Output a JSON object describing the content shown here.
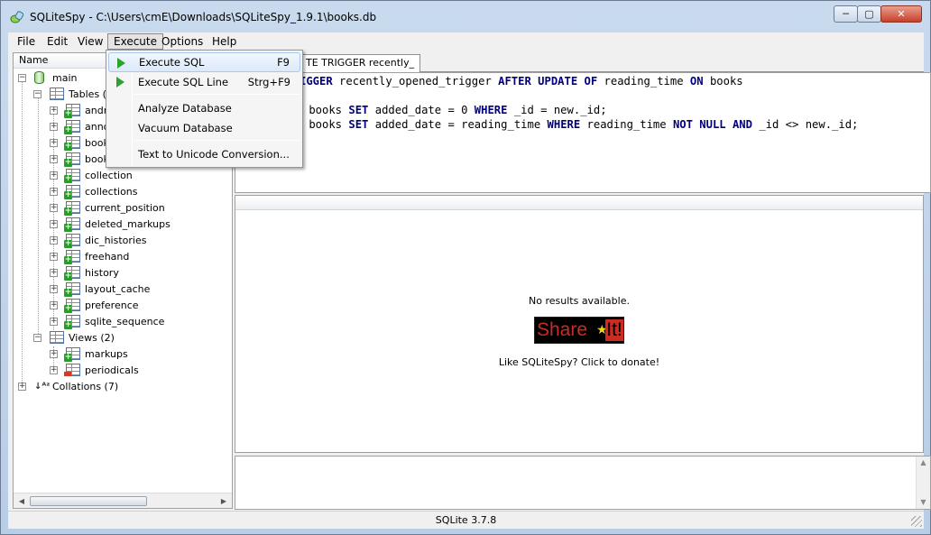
{
  "window": {
    "title": "SQLiteSpy - C:\\Users\\cmE\\Downloads\\SQLiteSpy_1.9.1\\books.db",
    "minimize": "─",
    "maximize": "▢",
    "close": "✕"
  },
  "menubar": [
    "File",
    "Edit",
    "View",
    "Execute",
    "Options",
    "Help"
  ],
  "execute_menu": {
    "items": [
      {
        "label": "Execute SQL",
        "shortcut": "F9",
        "icon": "play-icon"
      },
      {
        "label": "Execute SQL Line",
        "shortcut": "Strg+F9",
        "icon": "play-icon"
      },
      {
        "label": "Analyze Database"
      },
      {
        "label": "Vacuum Database"
      },
      {
        "label": "Text to Unicode Conversion..."
      }
    ]
  },
  "tree": {
    "header": "Name",
    "root": "main",
    "tables_label": "Tables (1",
    "tables": [
      "andro",
      "anno",
      "book",
      "book",
      "collection",
      "collections",
      "current_position",
      "deleted_markups",
      "dic_histories",
      "freehand",
      "history",
      "layout_cache",
      "preference",
      "sqlite_sequence"
    ],
    "views_label": "Views (2)",
    "views": [
      "markups",
      "periodicals"
    ],
    "collations_label": "Collations (7)"
  },
  "editor": {
    "tab_label": "TE TRIGGER recently_",
    "lines": [
      [
        {
          "t": "IGGER",
          "k": true
        },
        {
          "t": " recently_opened_trigger ",
          "k": false
        },
        {
          "t": "AFTER UPDATE OF",
          "k": true
        },
        {
          "t": " reading_time ",
          "k": false
        },
        {
          "t": "ON",
          "k": true
        },
        {
          "t": " books",
          "k": false
        }
      ],
      [],
      [
        {
          "t": " books ",
          "k": false
        },
        {
          "t": "SET",
          "k": true
        },
        {
          "t": " added_date = 0 ",
          "k": false
        },
        {
          "t": "WHERE",
          "k": true
        },
        {
          "t": " _id = new._id;",
          "k": false
        }
      ],
      [
        {
          "t": " books ",
          "k": false
        },
        {
          "t": "SET",
          "k": true
        },
        {
          "t": " added_date = reading_time ",
          "k": false
        },
        {
          "t": "WHERE",
          "k": true
        },
        {
          "t": " reading_time ",
          "k": false
        },
        {
          "t": "NOT NULL AND",
          "k": true
        },
        {
          "t": " _id <> new._id;",
          "k": false
        }
      ]
    ]
  },
  "results": {
    "message": "No results available.",
    "banner_share": "Share",
    "banner_it": "It!",
    "donate": "Like SQLiteSpy? Click to donate!"
  },
  "status": {
    "version": "SQLite 3.7.8"
  }
}
